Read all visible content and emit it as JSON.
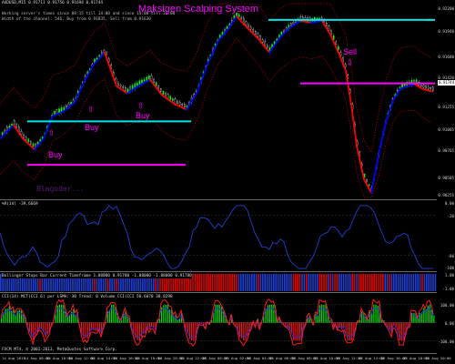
{
  "colors": {
    "bg": "#000000",
    "candle_up": "#00ff00",
    "candle_down": "#ffffff",
    "ma_up": "#0000ff",
    "ma_down": "#ff0000",
    "channel": "#b00000",
    "cyan": "#00e5e5",
    "magenta": "#ff00ff",
    "wpr_line": "#1f3fd0",
    "bb_blue": "#1f3fd0",
    "bb_red": "#e00000",
    "cci_red": "#ff1a1a",
    "cci_green": "#00ee00",
    "cci_blue": "#3030ff"
  },
  "main": {
    "header": "AUDUSD,M15  0.91711 0.91756 0.91694 0.91744",
    "info_line1": "Working server's times since 08:15 till 14:00 and since 14:00 till 22:00",
    "info_line2": "Width of the channel: 546, Buy from 0.91835, Sell from 0.91630",
    "title": "Maksigen Scalping System",
    "watermark": "Blagoder...",
    "annotations": {
      "buy1": "Buy",
      "buy2": "Buy",
      "buy3": "Buy",
      "sell": "Sell"
    },
    "arrow_glyphs": {
      "up": "⇧",
      "down": "⇩"
    },
    "price_labels": [
      "0.92200",
      "0.91940",
      "0.91680",
      "0.91420",
      "0.91255",
      "0.91005",
      "0.90765",
      "0.90505",
      "0.90255"
    ],
    "current_price": "0.91744"
  },
  "wpr": {
    "label": "%R(14) -39.6669",
    "levels": [
      "0.00",
      "-20",
      "-80",
      "-100"
    ]
  },
  "bb": {
    "label": "Bollinger Stops Bar  Current Timeframe  1.88000 0.91780 -1.88000 -1.88000 0.91780",
    "levels": [
      "1.00",
      "-1.00"
    ]
  },
  "cci": {
    "label": "CCI(14) MCT(CCI 6) per LSMA: 30 Trend: 0 Volume CCI(CCI 50.6070 38.8298",
    "footer": "FXCM MT4, © 2001-2013, MetaQuotes Software Corp.",
    "levels": [
      "100.00",
      "0.00",
      "-100.00"
    ]
  },
  "time_axis": [
    "14 Aug 2013",
    "14 Aug 08:00",
    "14 Aug 10:00",
    "14 Aug 12:00",
    "14 Aug 14:00",
    "14 Aug 16:00",
    "14 Aug 18:00",
    "14 Aug 20:00",
    "14 Aug 22:00",
    "15 Aug 00:00",
    "15 Aug 02:00",
    "15 Aug 04:00",
    "15 Aug 06:00",
    "15 Aug 08:00",
    "15 Aug 10:00",
    "15 Aug 12:00",
    "15 Aug 14:00",
    "15 Aug 16:00",
    "15 Aug 18:00",
    "15 Aug 20:00"
  ]
}
